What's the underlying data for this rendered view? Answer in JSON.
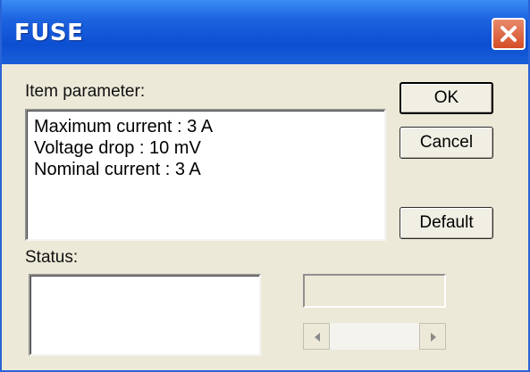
{
  "window": {
    "title": "FUSE",
    "close_icon": "close-x-icon"
  },
  "item_parameter": {
    "label": "Item parameter:",
    "lines": [
      "Maximum current : 3  A",
      "Voltage drop : 10  mV",
      "Nominal current : 3  A"
    ]
  },
  "buttons": {
    "ok": "OK",
    "cancel": "Cancel",
    "default": "Default"
  },
  "status": {
    "label": "Status:",
    "text": ""
  },
  "scrollbar": {
    "left_icon": "arrow-left-icon",
    "right_icon": "arrow-right-icon"
  },
  "colors": {
    "titlebar": "#0c4fd2",
    "close_button": "#d44d27",
    "dialog_face": "#ece9d8"
  }
}
